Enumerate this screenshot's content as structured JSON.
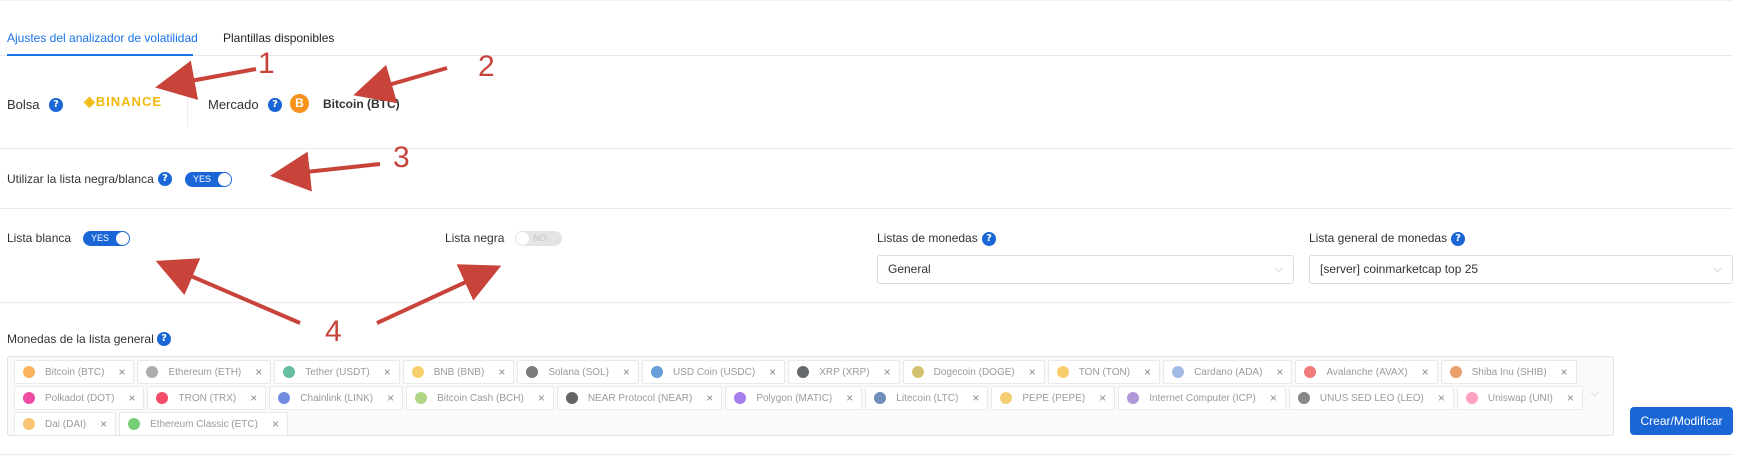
{
  "tabs": [
    {
      "label": "Ajustes del analizador de volatilidad",
      "active": true
    },
    {
      "label": "Plantillas disponibles",
      "active": false
    }
  ],
  "exchange": {
    "label": "Bolsa",
    "help": "?",
    "value": "BINANCE",
    "value_icon": "binance-logo-icon"
  },
  "market": {
    "label": "Mercado",
    "help": "?",
    "icon_glyph": "B",
    "icon": "bitcoin-icon",
    "value": "Bitcoin (BTC)"
  },
  "blacklist_whitelist": {
    "label": "Utilizar la lista negra/blanca",
    "help": "?",
    "toggle": "YES"
  },
  "whitelist": {
    "label": "Lista blanca",
    "toggle": "YES"
  },
  "blacklist": {
    "label": "Lista negra",
    "toggle": "NO"
  },
  "coin_lists": {
    "label": "Listas de monedas",
    "help": "?",
    "value": "General"
  },
  "general_list": {
    "label": "Lista general de monedas",
    "help": "?",
    "value": "[server] coinmarketcap top 25"
  },
  "general_coins": {
    "label": "Monedas de la lista general",
    "help": "?",
    "remove_glyph": "×",
    "coins": [
      {
        "name": "Bitcoin (BTC)",
        "color": "#f7931a"
      },
      {
        "name": "Ethereum (ETH)",
        "color": "#8a8a8a"
      },
      {
        "name": "Tether (USDT)",
        "color": "#26a17b"
      },
      {
        "name": "BNB (BNB)",
        "color": "#f3ba2f"
      },
      {
        "name": "Solana (SOL)",
        "color": "#444444"
      },
      {
        "name": "USD Coin (USDC)",
        "color": "#2775ca"
      },
      {
        "name": "XRP (XRP)",
        "color": "#23292f"
      },
      {
        "name": "Dogecoin (DOGE)",
        "color": "#c2a633"
      },
      {
        "name": "TON (TON)",
        "color": "#f5b830"
      },
      {
        "name": "Cardano (ADA)",
        "color": "#7b9ed9"
      },
      {
        "name": "Avalanche (AVAX)",
        "color": "#e84142"
      },
      {
        "name": "Shiba Inu (SHIB)",
        "color": "#e0782b"
      },
      {
        "name": "Polkadot (DOT)",
        "color": "#e6007a"
      },
      {
        "name": "TRON (TRX)",
        "color": "#ef0027"
      },
      {
        "name": "Chainlink (LINK)",
        "color": "#375bd2"
      },
      {
        "name": "Bitcoin Cash (BCH)",
        "color": "#8dc351"
      },
      {
        "name": "NEAR Protocol (NEAR)",
        "color": "#222222"
      },
      {
        "name": "Polygon (MATIC)",
        "color": "#8247e5"
      },
      {
        "name": "Litecoin (LTC)",
        "color": "#345d9d"
      },
      {
        "name": "PEPE (PEPE)",
        "color": "#f0b93a"
      },
      {
        "name": "Internet Computer (ICP)",
        "color": "#8e6bc8"
      },
      {
        "name": "UNUS SED LEO (LEO)",
        "color": "#555555"
      },
      {
        "name": "Uniswap (UNI)",
        "color": "#ff79a8"
      },
      {
        "name": "Dai (DAI)",
        "color": "#f5ac37"
      },
      {
        "name": "Ethereum Classic (ETC)",
        "color": "#3ab83a"
      }
    ]
  },
  "create_button": "Crear/Modificar",
  "annotations": [
    "1",
    "2",
    "3",
    "4"
  ],
  "chevron_glyph": "⌵",
  "accent_color": "#1a66d6",
  "annotation_color": "#c8443a"
}
